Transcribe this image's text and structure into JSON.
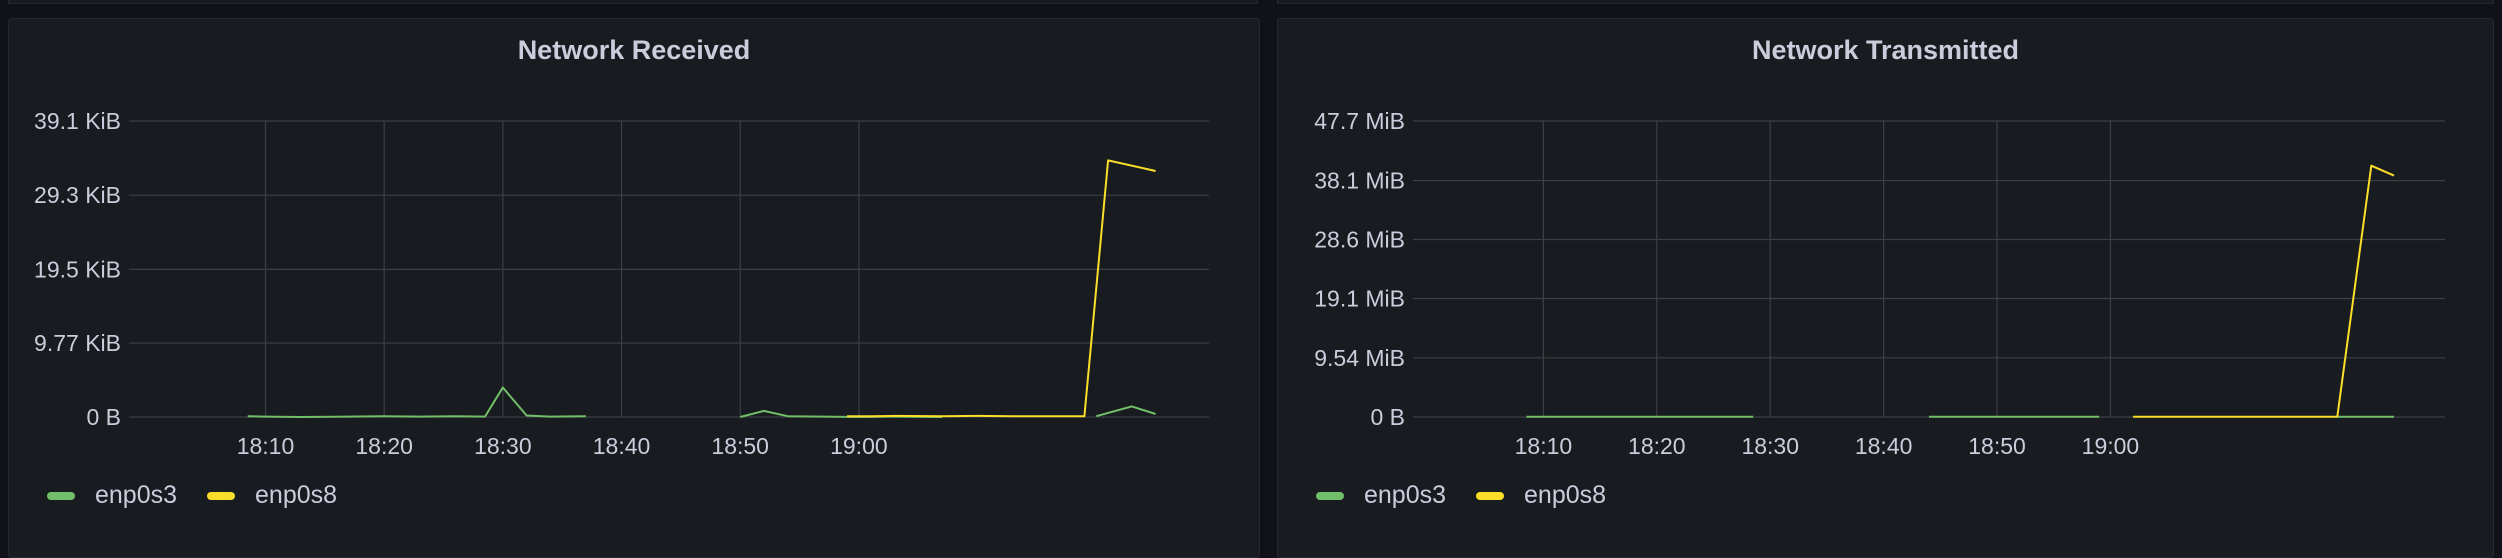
{
  "colors": {
    "enp0s3": "#73bf69",
    "enp0s8": "#fade2a",
    "grid": "#3c3f44",
    "text": "#ccccdc"
  },
  "chart_data": [
    {
      "type": "line",
      "title": "Network Received",
      "xlabel": "",
      "ylabel": "",
      "x_range_minutes": [
        -11.5,
        79.5
      ],
      "x_tick_values": [
        0,
        10,
        20,
        30,
        40,
        50
      ],
      "x_tick_labels": [
        "18:10",
        "18:20",
        "18:30",
        "18:40",
        "18:50",
        "19:00"
      ],
      "y_tick_values": [
        0,
        9.77,
        19.5,
        29.3,
        39.1
      ],
      "y_tick_labels": [
        "0 B",
        "9.77 KiB",
        "19.5 KiB",
        "29.3 KiB",
        "39.1 KiB"
      ],
      "ylim": [
        0,
        39.1
      ],
      "grid": true,
      "legend": "bottom-left",
      "series": [
        {
          "name": "enp0s3",
          "color": "#73bf69",
          "segments": [
            [
              [
                -1.5,
                0.1
              ],
              [
                0,
                0.05
              ],
              [
                3,
                0
              ],
              [
                7,
                0.05
              ],
              [
                10,
                0.1
              ],
              [
                13,
                0.05
              ],
              [
                16,
                0.1
              ],
              [
                18.5,
                0.05
              ],
              [
                20,
                3.9
              ],
              [
                22,
                0.2
              ],
              [
                24,
                0.05
              ],
              [
                27,
                0.1
              ]
            ],
            [
              [
                40,
                0
              ],
              [
                42,
                0.8
              ],
              [
                44,
                0.1
              ],
              [
                47,
                0.05
              ],
              [
                50,
                0
              ],
              [
                53,
                0.05
              ],
              [
                57,
                0
              ]
            ],
            [
              [
                70,
                0.1
              ],
              [
                73,
                1.4
              ],
              [
                75,
                0.4
              ]
            ]
          ]
        },
        {
          "name": "enp0s8",
          "color": "#fade2a",
          "segments": [
            [
              [
                49,
                0.1
              ],
              [
                51,
                0.1
              ],
              [
                53,
                0.15
              ],
              [
                57,
                0.1
              ],
              [
                60,
                0.15
              ],
              [
                63,
                0.1
              ],
              [
                65,
                0.1
              ],
              [
                69,
                0.1
              ],
              [
                71,
                33.9
              ],
              [
                75,
                32.5
              ]
            ]
          ]
        }
      ]
    },
    {
      "type": "line",
      "title": "Network Transmitted",
      "xlabel": "",
      "ylabel": "",
      "x_range_minutes": [
        -11.5,
        79.5
      ],
      "x_tick_values": [
        0,
        10,
        20,
        30,
        40,
        50
      ],
      "x_tick_labels": [
        "18:10",
        "18:20",
        "18:30",
        "18:40",
        "18:50",
        "19:00"
      ],
      "y_tick_values": [
        0,
        9.54,
        19.1,
        28.6,
        38.1,
        47.7
      ],
      "y_tick_labels": [
        "0 B",
        "9.54 MiB",
        "19.1 MiB",
        "28.6 MiB",
        "38.1 MiB",
        "47.7 MiB"
      ],
      "ylim": [
        0,
        47.7
      ],
      "grid": true,
      "legend": "bottom-left",
      "series": [
        {
          "name": "enp0s3",
          "color": "#73bf69",
          "segments": [
            [
              [
                -1.5,
                0.05
              ],
              [
                5,
                0.05
              ],
              [
                10,
                0.05
              ],
              [
                15,
                0.05
              ],
              [
                18.5,
                0.05
              ]
            ],
            [
              [
                34,
                0.05
              ],
              [
                40,
                0.05
              ],
              [
                45,
                0.05
              ],
              [
                49,
                0.05
              ]
            ],
            [
              [
                70,
                0.05
              ],
              [
                75,
                0.05
              ]
            ]
          ]
        },
        {
          "name": "enp0s8",
          "color": "#fade2a",
          "segments": [
            [
              [
                52,
                0.05
              ],
              [
                55,
                0.05
              ],
              [
                60,
                0.05
              ],
              [
                65,
                0.05
              ],
              [
                70,
                0.05
              ],
              [
                73,
                40.5
              ],
              [
                75,
                38.9
              ]
            ]
          ]
        }
      ]
    }
  ]
}
